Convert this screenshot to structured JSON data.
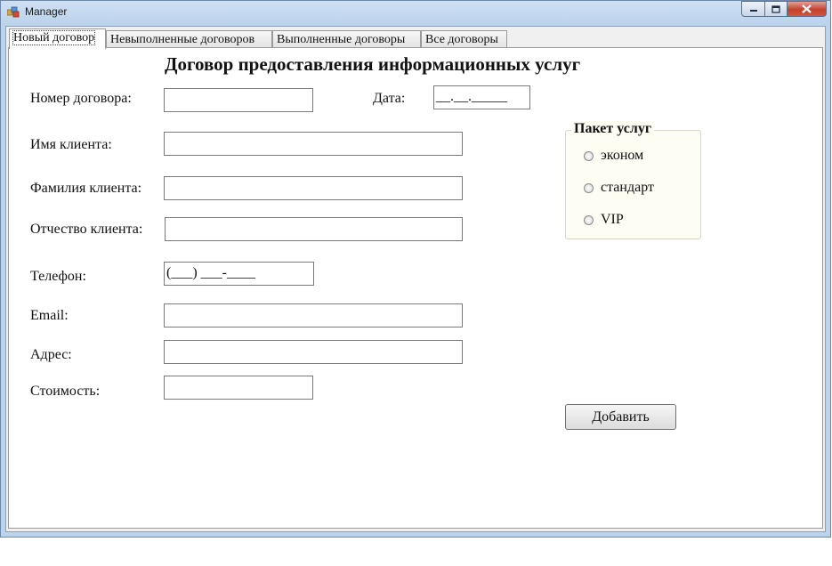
{
  "window": {
    "title": "Manager"
  },
  "tabs": [
    {
      "label": "Новый договор",
      "active": true
    },
    {
      "label": "Невыполненные договоров",
      "active": false
    },
    {
      "label": "Выполненные договоры",
      "active": false
    },
    {
      "label": "Все договоры",
      "active": false
    }
  ],
  "form": {
    "heading": "Договор предоставления информационных услуг",
    "contract_number_label": "Номер договора:",
    "contract_number_value": "",
    "date_label": "Дата:",
    "date_mask": "__.__._____",
    "first_name_label": "Имя клиента:",
    "first_name_value": "",
    "last_name_label": "Фамилия клиента:",
    "last_name_value": "",
    "patronymic_label": "Отчество клиента:",
    "patronymic_value": "",
    "phone_label": "Телефон:",
    "phone_mask": "(___) ___-____",
    "email_label": "Email:",
    "email_value": "",
    "address_label": "Адрес:",
    "address_value": "",
    "cost_label": "Стоимость:",
    "cost_value": ""
  },
  "package_group": {
    "title": "Пакет услуг",
    "options": [
      "эконом",
      "стандарт",
      "VIP"
    ]
  },
  "add_button_label": "Добавить",
  "colors": {
    "close_button": "#c2412b",
    "titlebar": "#bcd3ec"
  },
  "icons": [
    "app-icon",
    "minimize-icon",
    "maximize-icon",
    "close-icon"
  ]
}
